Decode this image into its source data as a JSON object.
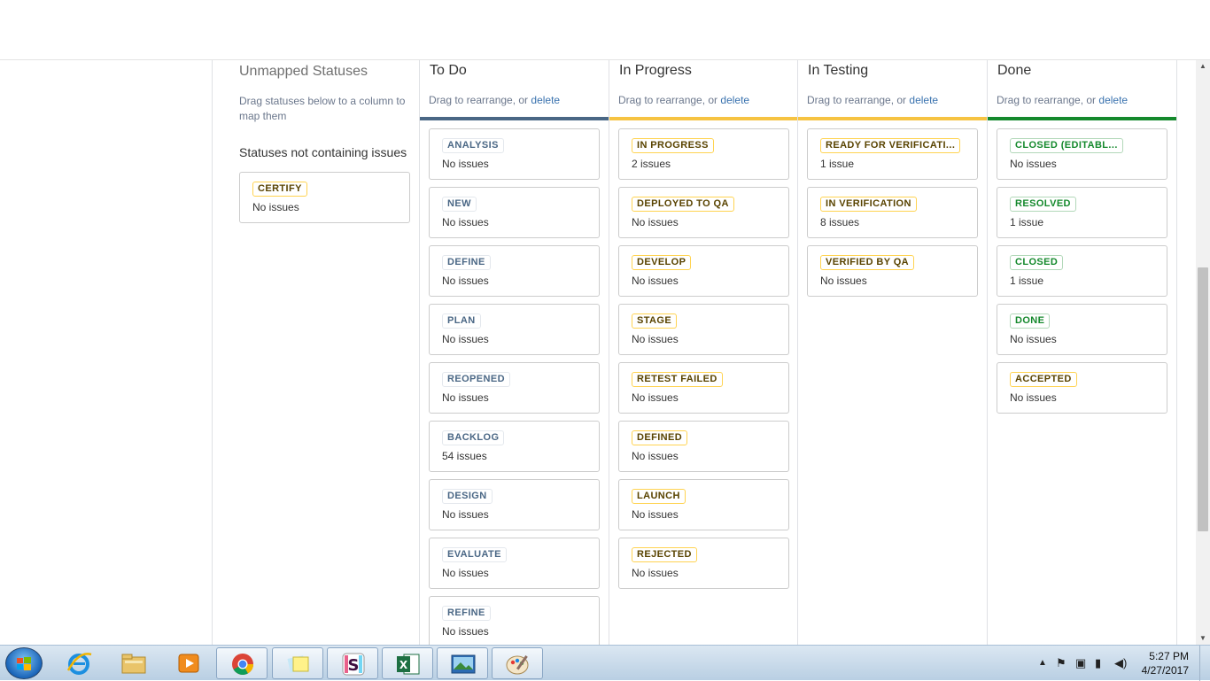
{
  "unmapped": {
    "title": "Unmapped Statuses",
    "description": "Drag statuses below to a column to map them",
    "subheading": "Statuses not containing issues",
    "cards": [
      {
        "status": "CERTIFY",
        "count": "No issues",
        "tone": "yellow"
      }
    ]
  },
  "columns": [
    {
      "title": "To Do",
      "subtitle_prefix": "Drag to rearrange, or ",
      "delete_label": "delete",
      "bar_color": "#4a6785",
      "cards": [
        {
          "status": "ANALYSIS",
          "count": "No issues",
          "tone": "blue"
        },
        {
          "status": "NEW",
          "count": "No issues",
          "tone": "blue"
        },
        {
          "status": "DEFINE",
          "count": "No issues",
          "tone": "blue"
        },
        {
          "status": "PLAN",
          "count": "No issues",
          "tone": "blue"
        },
        {
          "status": "REOPENED",
          "count": "No issues",
          "tone": "blue"
        },
        {
          "status": "BACKLOG",
          "count": "54 issues",
          "tone": "blue"
        },
        {
          "status": "DESIGN",
          "count": "No issues",
          "tone": "blue"
        },
        {
          "status": "EVALUATE",
          "count": "No issues",
          "tone": "blue"
        },
        {
          "status": "REFINE",
          "count": "No issues",
          "tone": "blue"
        }
      ]
    },
    {
      "title": "In Progress",
      "subtitle_prefix": "Drag to rearrange, or ",
      "delete_label": "delete",
      "bar_color": "#f6c342",
      "cards": [
        {
          "status": "IN PROGRESS",
          "count": "2 issues",
          "tone": "yellow"
        },
        {
          "status": "DEPLOYED TO QA",
          "count": "No issues",
          "tone": "yellow"
        },
        {
          "status": "DEVELOP",
          "count": "No issues",
          "tone": "yellow"
        },
        {
          "status": "STAGE",
          "count": "No issues",
          "tone": "yellow"
        },
        {
          "status": "RETEST FAILED",
          "count": "No issues",
          "tone": "yellow"
        },
        {
          "status": "DEFINED",
          "count": "No issues",
          "tone": "yellow"
        },
        {
          "status": "LAUNCH",
          "count": "No issues",
          "tone": "yellow"
        },
        {
          "status": "REJECTED",
          "count": "No issues",
          "tone": "yellow"
        }
      ]
    },
    {
      "title": "In Testing",
      "subtitle_prefix": "Drag to rearrange, or ",
      "delete_label": "delete",
      "bar_color": "#f6c342",
      "cards": [
        {
          "status": "READY FOR VERIFICATI...",
          "count": "1 issue",
          "tone": "yellow"
        },
        {
          "status": "IN VERIFICATION",
          "count": "8 issues",
          "tone": "yellow"
        },
        {
          "status": "VERIFIED BY QA",
          "count": "No issues",
          "tone": "yellow"
        }
      ]
    },
    {
      "title": "Done",
      "subtitle_prefix": "Drag to rearrange, or ",
      "delete_label": "delete",
      "bar_color": "#14892c",
      "cards": [
        {
          "status": "CLOSED (EDITABL...",
          "count": "No issues",
          "tone": "green"
        },
        {
          "status": "RESOLVED",
          "count": "1 issue",
          "tone": "green"
        },
        {
          "status": "CLOSED",
          "count": "1 issue",
          "tone": "green"
        },
        {
          "status": "DONE",
          "count": "No issues",
          "tone": "green"
        },
        {
          "status": "ACCEPTED",
          "count": "No issues",
          "tone": "yellow"
        }
      ]
    }
  ],
  "taskbar": {
    "apps": [
      {
        "name": "internet-explorer-icon",
        "active": false
      },
      {
        "name": "file-explorer-icon",
        "active": false
      },
      {
        "name": "media-player-icon",
        "active": false
      },
      {
        "name": "chrome-icon",
        "active": true
      },
      {
        "name": "sticky-notes-icon",
        "active": true
      },
      {
        "name": "slack-icon",
        "active": true
      },
      {
        "name": "excel-icon",
        "active": true
      },
      {
        "name": "photo-viewer-icon",
        "active": true
      },
      {
        "name": "paint-icon",
        "active": true
      }
    ],
    "time": "5:27 PM",
    "date": "4/27/2017"
  }
}
